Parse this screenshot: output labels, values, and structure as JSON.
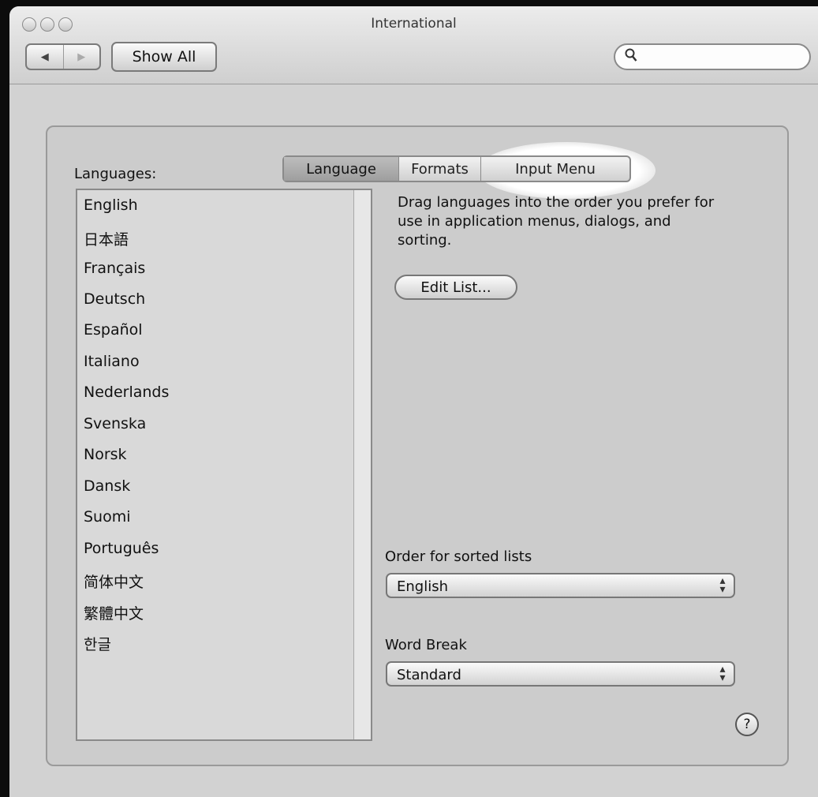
{
  "window": {
    "title": "International"
  },
  "toolbar": {
    "back_icon": "◀",
    "forward_icon": "▶",
    "show_all_label": "Show All",
    "search_icon": "🔍",
    "search_value": ""
  },
  "tabs": [
    {
      "label": "Language",
      "selected": true
    },
    {
      "label": "Formats",
      "selected": false
    },
    {
      "label": "Input Menu",
      "selected": false
    }
  ],
  "languages": {
    "label": "Languages:",
    "items": [
      "English",
      "日本語",
      "Français",
      "Deutsch",
      "Español",
      "Italiano",
      "Nederlands",
      "Svenska",
      "Norsk",
      "Dansk",
      "Suomi",
      "Português",
      "简体中文",
      "繁體中文",
      "한글"
    ]
  },
  "description": "Drag languages into the order you prefer for use in application menus, dialogs, and sorting.",
  "edit_list_label": "Edit List...",
  "sorted_lists": {
    "label": "Order for sorted lists",
    "value": "English"
  },
  "word_break": {
    "label": "Word Break",
    "value": "Standard"
  },
  "help_label": "?"
}
